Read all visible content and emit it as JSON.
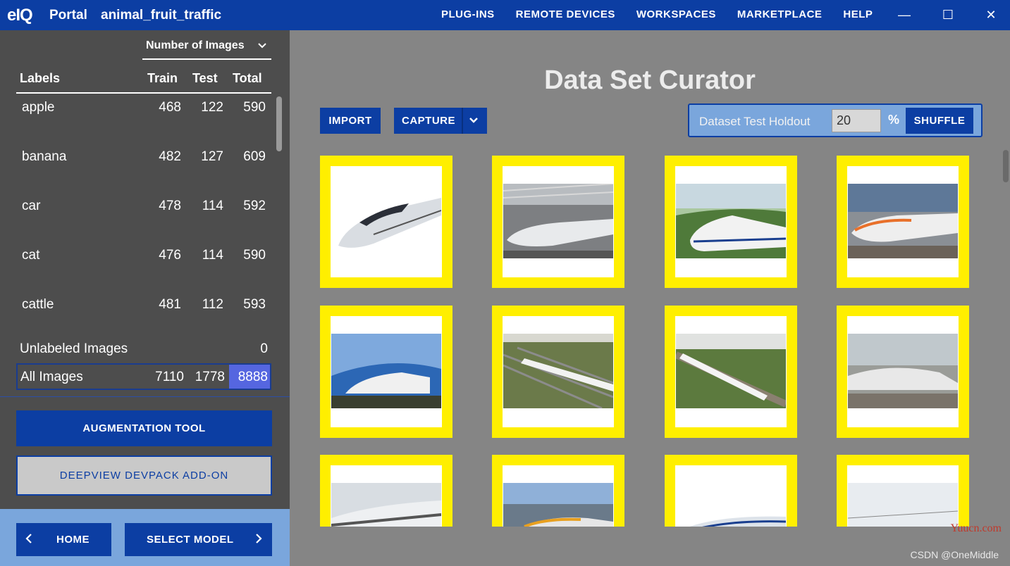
{
  "titlebar": {
    "logo": "eIQ",
    "app_name": "Portal",
    "project_name": "animal_fruit_traffic",
    "menu": [
      "PLUG-INS",
      "REMOTE DEVICES",
      "WORKSPACES",
      "MARKETPLACE",
      "HELP"
    ],
    "minimize": "—",
    "maximize": "☐",
    "close": "✕"
  },
  "sidebar": {
    "count_select": "Number of Images",
    "columns": {
      "labels": "Labels",
      "train": "Train",
      "test": "Test",
      "total": "Total"
    },
    "rows": [
      {
        "label": "apple",
        "train": "468",
        "test": "122",
        "total": "590"
      },
      {
        "label": "banana",
        "train": "482",
        "test": "127",
        "total": "609"
      },
      {
        "label": "car",
        "train": "478",
        "test": "114",
        "total": "592"
      },
      {
        "label": "cat",
        "train": "476",
        "test": "114",
        "total": "590"
      },
      {
        "label": "cattle",
        "train": "481",
        "test": "112",
        "total": "593"
      }
    ],
    "unlabeled": {
      "label": "Unlabeled Images",
      "value": "0"
    },
    "all_images": {
      "label": "All Images",
      "train": "7110",
      "test": "1778",
      "total": "8888"
    },
    "augmentation_button": "AUGMENTATION TOOL",
    "devpack_button": "DEEPVIEW DEVPACK ADD-ON",
    "home_button": "HOME",
    "select_model_button": "SELECT MODEL"
  },
  "main": {
    "title": "Data Set Curator",
    "import_button": "IMPORT",
    "capture_button": "CAPTURE",
    "holdout_label": "Dataset Test Holdout",
    "holdout_value": "20",
    "holdout_unit": "%",
    "shuffle_button": "SHUFFLE",
    "image_count_visible": 12,
    "selection_color": "#ffef00"
  },
  "watermarks": {
    "yuucn": "Yuucn.com",
    "csdn": "CSDN @OneMiddle"
  },
  "colors": {
    "primary": "#0c3ea3",
    "sidebar_bg": "#4d4d4d",
    "main_bg": "#858585",
    "highlight": "#5566e0"
  }
}
